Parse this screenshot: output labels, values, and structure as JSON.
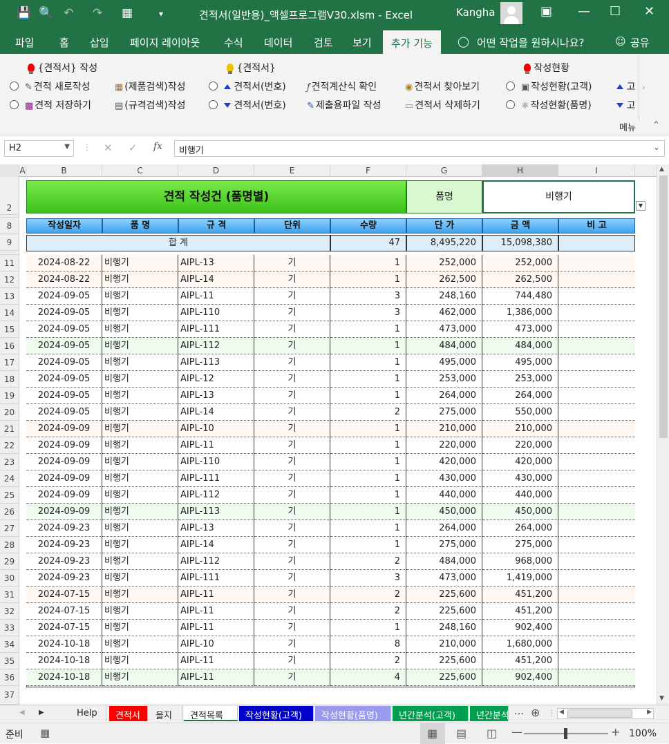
{
  "titlebar": {
    "title": "견적서(일반용)_액셀프로그램V30.xlsm  -  Excel",
    "user": "Kangha"
  },
  "ribbon_tabs": [
    "파일",
    "홈",
    "삽입",
    "페이지 레이아웃",
    "수식",
    "데이터",
    "검토",
    "보기",
    "추가 기능"
  ],
  "ribbon_search": "어떤 작업을 원하시나요?",
  "ribbon_share": "공유",
  "ribbon": {
    "group1_title": "{견적서} 작성",
    "new_quote": "견적 새로작성",
    "save_quote": "견적 저장하기",
    "product_search": "(제품검색)작성",
    "spec_search": "(규격검색)작성",
    "group2_title": "{견적서}",
    "quote_no_up": "견적서(번호)",
    "quote_no_down": "견적서(번호)",
    "formula_check": "견적계산식 확인",
    "submit_file": "제출용파일 작성",
    "find_quote": "견적서 찾아보기",
    "delete_quote": "견적서 삭제하기",
    "group3_title": "작성현황",
    "status_customer": "작성현황(고객)",
    "status_product": "작성현황(품명)",
    "cut_up": "고",
    "cut_down": "고",
    "menu_label": "메뉴"
  },
  "namebox": "H2",
  "formula": "비행기",
  "columns": [
    "A",
    "B",
    "C",
    "D",
    "E",
    "F",
    "G",
    "H",
    "I"
  ],
  "sheet": {
    "banner_title": "견적 작성건 (품명별)",
    "filter_label": "품명",
    "filter_value": "비행기",
    "headers": [
      "작성일자",
      "품    명",
      "규    격",
      "단위",
      "수량",
      "단    가",
      "금    액",
      "비  고"
    ],
    "total_label": "합    계",
    "total_qty": "47",
    "total_unit_price": "8,495,220",
    "total_amount": "15,098,380",
    "rows": [
      [
        "2024-08-22",
        "비행기",
        "AIPL-13",
        "기",
        "1",
        "252,000",
        "252,000"
      ],
      [
        "2024-08-22",
        "비행기",
        "AIPL-14",
        "기",
        "1",
        "262,500",
        "262,500"
      ],
      [
        "2024-09-05",
        "비행기",
        "AIPL-11",
        "기",
        "3",
        "248,160",
        "744,480"
      ],
      [
        "2024-09-05",
        "비행기",
        "AIPL-110",
        "기",
        "3",
        "462,000",
        "1,386,000"
      ],
      [
        "2024-09-05",
        "비행기",
        "AIPL-111",
        "기",
        "1",
        "473,000",
        "473,000"
      ],
      [
        "2024-09-05",
        "비행기",
        "AIPL-112",
        "기",
        "1",
        "484,000",
        "484,000"
      ],
      [
        "2024-09-05",
        "비행기",
        "AIPL-113",
        "기",
        "1",
        "495,000",
        "495,000"
      ],
      [
        "2024-09-05",
        "비행기",
        "AIPL-12",
        "기",
        "1",
        "253,000",
        "253,000"
      ],
      [
        "2024-09-05",
        "비행기",
        "AIPL-13",
        "기",
        "1",
        "264,000",
        "264,000"
      ],
      [
        "2024-09-05",
        "비행기",
        "AIPL-14",
        "기",
        "2",
        "275,000",
        "550,000"
      ],
      [
        "2024-09-09",
        "비행기",
        "AIPL-10",
        "기",
        "1",
        "210,000",
        "210,000"
      ],
      [
        "2024-09-09",
        "비행기",
        "AIPL-11",
        "기",
        "1",
        "220,000",
        "220,000"
      ],
      [
        "2024-09-09",
        "비행기",
        "AIPL-110",
        "기",
        "1",
        "420,000",
        "420,000"
      ],
      [
        "2024-09-09",
        "비행기",
        "AIPL-111",
        "기",
        "1",
        "430,000",
        "430,000"
      ],
      [
        "2024-09-09",
        "비행기",
        "AIPL-112",
        "기",
        "1",
        "440,000",
        "440,000"
      ],
      [
        "2024-09-09",
        "비행기",
        "AIPL-113",
        "기",
        "1",
        "450,000",
        "450,000"
      ],
      [
        "2024-09-23",
        "비행기",
        "AIPL-13",
        "기",
        "1",
        "264,000",
        "264,000"
      ],
      [
        "2024-09-23",
        "비행기",
        "AIPL-14",
        "기",
        "1",
        "275,000",
        "275,000"
      ],
      [
        "2024-09-23",
        "비행기",
        "AIPL-112",
        "기",
        "2",
        "484,000",
        "968,000"
      ],
      [
        "2024-09-23",
        "비행기",
        "AIPL-111",
        "기",
        "3",
        "473,000",
        "1,419,000"
      ],
      [
        "2024-07-15",
        "비행기",
        "AIPL-11",
        "기",
        "2",
        "225,600",
        "451,200"
      ],
      [
        "2024-07-15",
        "비행기",
        "AIPL-11",
        "기",
        "2",
        "225,600",
        "451,200"
      ],
      [
        "2024-07-15",
        "비행기",
        "AIPL-11",
        "기",
        "1",
        "248,160",
        "902,400"
      ],
      [
        "2024-10-18",
        "비행기",
        "AIPL-10",
        "기",
        "8",
        "210,000",
        "1,680,000"
      ],
      [
        "2024-10-18",
        "비행기",
        "AIPL-11",
        "기",
        "2",
        "225,600",
        "451,200"
      ],
      [
        "2024-10-18",
        "비행기",
        "AIPL-11",
        "기",
        "4",
        "225,600",
        "902,400"
      ]
    ],
    "row_numbers": [
      "2",
      "8",
      "9",
      "11",
      "12",
      "13",
      "14",
      "15",
      "16",
      "17",
      "18",
      "19",
      "20",
      "21",
      "22",
      "23",
      "24",
      "25",
      "26",
      "27",
      "28",
      "29",
      "30",
      "31",
      "32",
      "33",
      "34",
      "35",
      "36",
      "37"
    ]
  },
  "sheet_tabs": [
    {
      "label": "Help",
      "bg": "#f0f0f0",
      "fg": "#222"
    },
    {
      "label": "견적서",
      "bg": "#ff0000",
      "fg": "#ffffff"
    },
    {
      "label": "을지",
      "bg": "#f0f0f0",
      "fg": "#222"
    },
    {
      "label": "견적목록",
      "bg": "#ffffff",
      "fg": "#222"
    },
    {
      "label": "작성현황(고객)",
      "bg": "#0000cc",
      "fg": "#ffffff"
    },
    {
      "label": "작성현황(품명)",
      "bg": "#9999ee",
      "fg": "#ffffff"
    },
    {
      "label": "년간분석(고객)",
      "bg": "#00a050",
      "fg": "#ffffff"
    },
    {
      "label": "년간분석",
      "bg": "#00a050",
      "fg": "#ffffff"
    }
  ],
  "status": {
    "ready": "준비",
    "zoom": "100%"
  },
  "colors": {
    "excel_green": "#217346",
    "banner_green": "#55d633",
    "header_blue": "#5ab0f0",
    "total_row": "#ddeefa"
  }
}
